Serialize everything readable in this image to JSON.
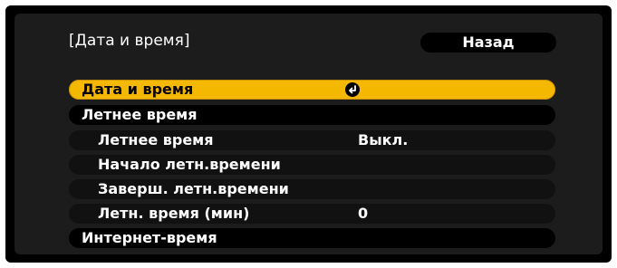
{
  "header": {
    "title": "[Дата и время]",
    "back_label": "Назад"
  },
  "menu": [
    {
      "label": "Дата и время",
      "value": "",
      "icon": "enter-icon",
      "level": "top",
      "selected": true
    },
    {
      "label": "Летнее время",
      "value": "",
      "level": "top",
      "selected": false
    },
    {
      "label": "Летнее время",
      "value": "Выкл.",
      "level": "sub",
      "selected": false
    },
    {
      "label": "Начало летн.времени",
      "value": "",
      "level": "sub",
      "selected": false
    },
    {
      "label": "Заверш. летн.времени",
      "value": "",
      "level": "sub",
      "selected": false
    },
    {
      "label": "Летн. время (мин)",
      "value": "0",
      "level": "sub",
      "selected": false
    },
    {
      "label": "Интернет-время",
      "value": "",
      "level": "top",
      "selected": false
    }
  ],
  "colors": {
    "highlight": "#f5b800",
    "panel": "#1c1c1c",
    "frame": "#000000",
    "text": "#ffffff"
  }
}
